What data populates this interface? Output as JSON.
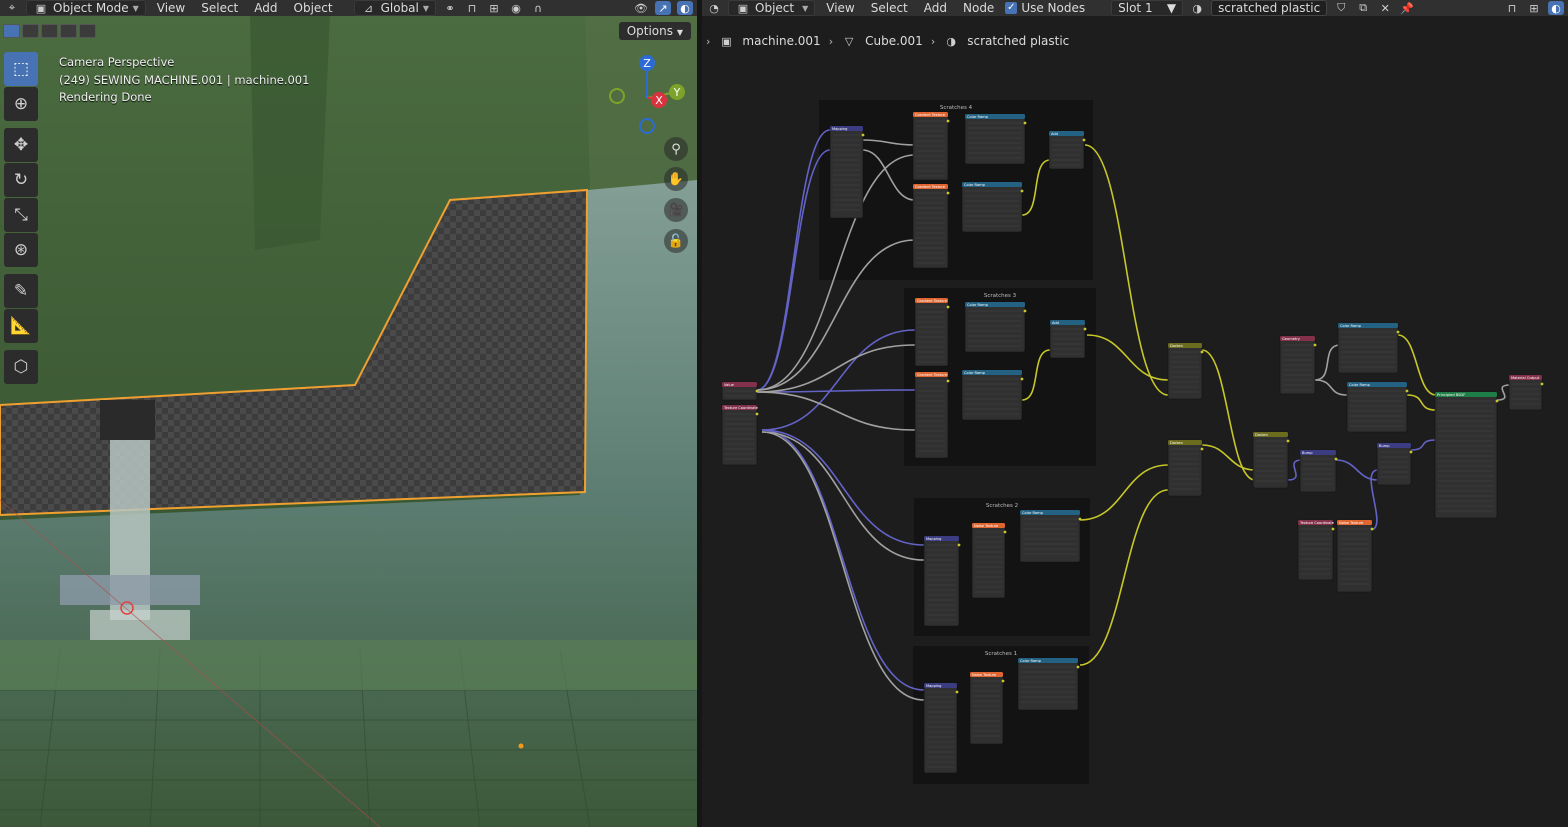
{
  "viewport_header": {
    "mode": "Object Mode",
    "menus": [
      "View",
      "Select",
      "Add",
      "Object"
    ],
    "transform_orientation": "Global"
  },
  "viewport": {
    "options_label": "Options",
    "overlay": {
      "line1": "Camera Perspective",
      "line2": "(249) SEWING MACHINE.001 | machine.001",
      "line3": "Rendering Done"
    },
    "gizmo": {
      "z": "Z",
      "y": "Y",
      "x": "X"
    }
  },
  "node_header": {
    "type": "Object",
    "menus": [
      "View",
      "Select",
      "Add",
      "Node"
    ],
    "use_nodes_label": "Use Nodes",
    "slot": "Slot 1",
    "material": "scratched plastic"
  },
  "breadcrumb": {
    "object": "machine.001",
    "mesh": "Cube.001",
    "material": "scratched plastic"
  },
  "frames": [
    {
      "label": "Scratches 4"
    },
    {
      "label": "Scratches 3"
    },
    {
      "label": "Scratches 2"
    },
    {
      "label": "Scratches 1"
    }
  ],
  "nodes": {
    "mapping": "Mapping",
    "gradient": "Gradient Texture",
    "color_ramp": "Color Ramp",
    "add": "Add",
    "noise": "Noise Texture",
    "value": "Value",
    "texcoord": "Texture Coordinate",
    "darken": "Darken",
    "geometry": "Geometry",
    "bump": "Bump",
    "principled": "Principled BSDF",
    "output": "Material Output"
  },
  "colors": {
    "frame": "#131313",
    "node_body": "#303030",
    "header_vector": "#3c3c83",
    "header_texture": "#e06631",
    "header_converter": "#246283",
    "header_input": "#83314a",
    "header_color": "#6c6c1e",
    "header_shader": "#1f7d47",
    "wire_yellow": "#c7c729",
    "wire_purple": "#6363c7",
    "wire_grey": "#a1a1a1"
  }
}
